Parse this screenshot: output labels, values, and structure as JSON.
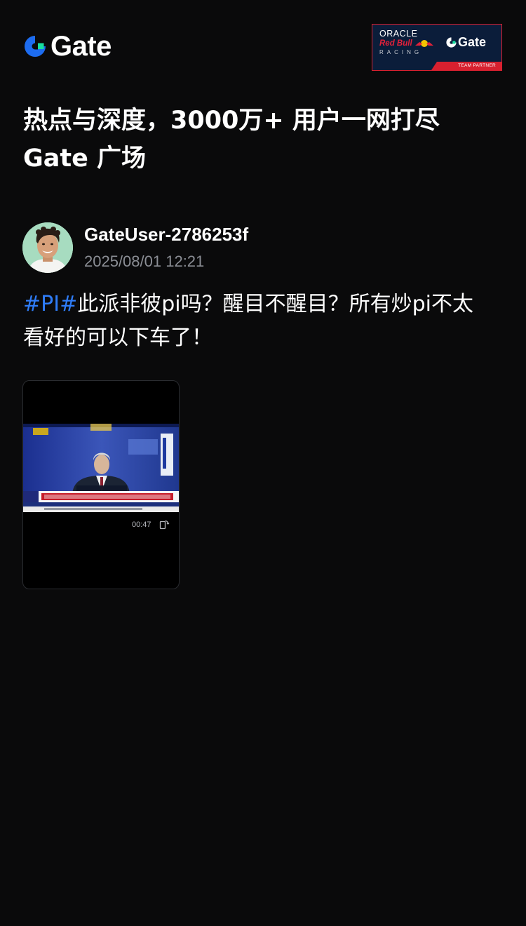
{
  "header": {
    "brand_name": "Gate",
    "partner_badge": {
      "line1": "ORACLE",
      "line2": "Red Bull",
      "line3": "RACING",
      "brand": "Gate",
      "strip": "TEAM PARTNER"
    }
  },
  "headline": {
    "line1": "热点与深度，3000万+ 用户一网打尽",
    "line2": "Gate 广场"
  },
  "post": {
    "author": "GateUser-2786253f",
    "timestamp": "2025/08/01 12:21",
    "hashtag": "#PI#",
    "text_line1": "此派非彼pi吗？醒目不醒目？所有炒pi不太",
    "text_line2": "看好的可以下车了！",
    "video": {
      "duration": "00:47",
      "rotate_icon": "rotate-screen-icon"
    }
  },
  "colors": {
    "background": "#0a0a0b",
    "hashtag": "#2f7cf6",
    "brand_blue": "#1d6cf0",
    "brand_green": "#17e0a0",
    "muted_text": "#8b8e95"
  }
}
